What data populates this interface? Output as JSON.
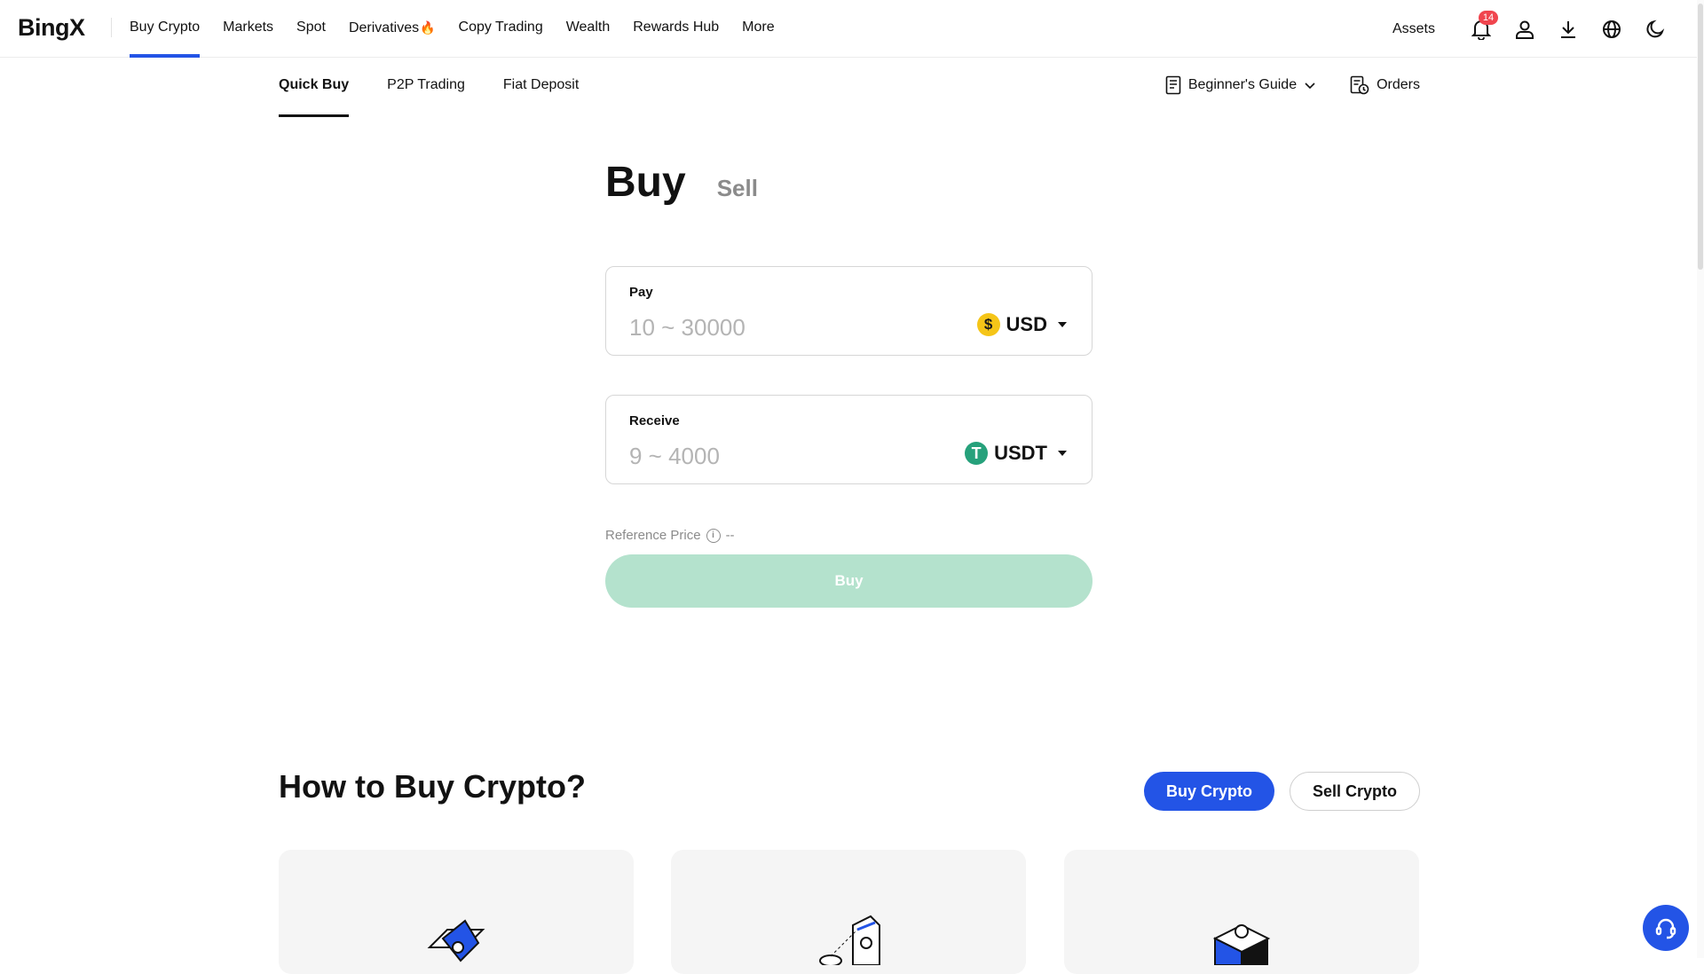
{
  "brand": {
    "logo_text": "BingX",
    "accent_color": "#2354e6",
    "buy_color": "#b4e2cd"
  },
  "topnav": {
    "items": [
      {
        "label": "Buy Crypto",
        "active": true
      },
      {
        "label": "Markets"
      },
      {
        "label": "Spot"
      },
      {
        "label": "Derivatives",
        "icon": "fire-icon"
      },
      {
        "label": "Copy Trading"
      },
      {
        "label": "Wealth"
      },
      {
        "label": "Rewards Hub"
      },
      {
        "label": "More"
      }
    ],
    "assets_label": "Assets",
    "notification_count": "14",
    "icons": [
      "bell-icon",
      "user-icon",
      "download-icon",
      "globe-icon",
      "moon-icon"
    ]
  },
  "subnav": {
    "tabs": [
      {
        "label": "Quick Buy",
        "active": true
      },
      {
        "label": "P2P Trading"
      },
      {
        "label": "Fiat Deposit"
      }
    ],
    "guide_label": "Beginner's Guide",
    "orders_label": "Orders"
  },
  "trade": {
    "tab_buy": "Buy",
    "tab_sell": "Sell",
    "pay": {
      "label": "Pay",
      "placeholder": "10 ~ 30000",
      "currency": "USD",
      "coin_symbol": "$",
      "coin_color": "#f5c518"
    },
    "receive": {
      "label": "Receive",
      "placeholder": "9 ~ 4000",
      "currency": "USDT",
      "coin_symbol": "T",
      "coin_color": "#26a17b"
    },
    "reference_price_label": "Reference Price",
    "reference_price_value": "--",
    "buy_button": "Buy"
  },
  "how_to": {
    "title": "How to Buy Crypto?",
    "buy_button": "Buy Crypto",
    "sell_button": "Sell Crypto"
  }
}
